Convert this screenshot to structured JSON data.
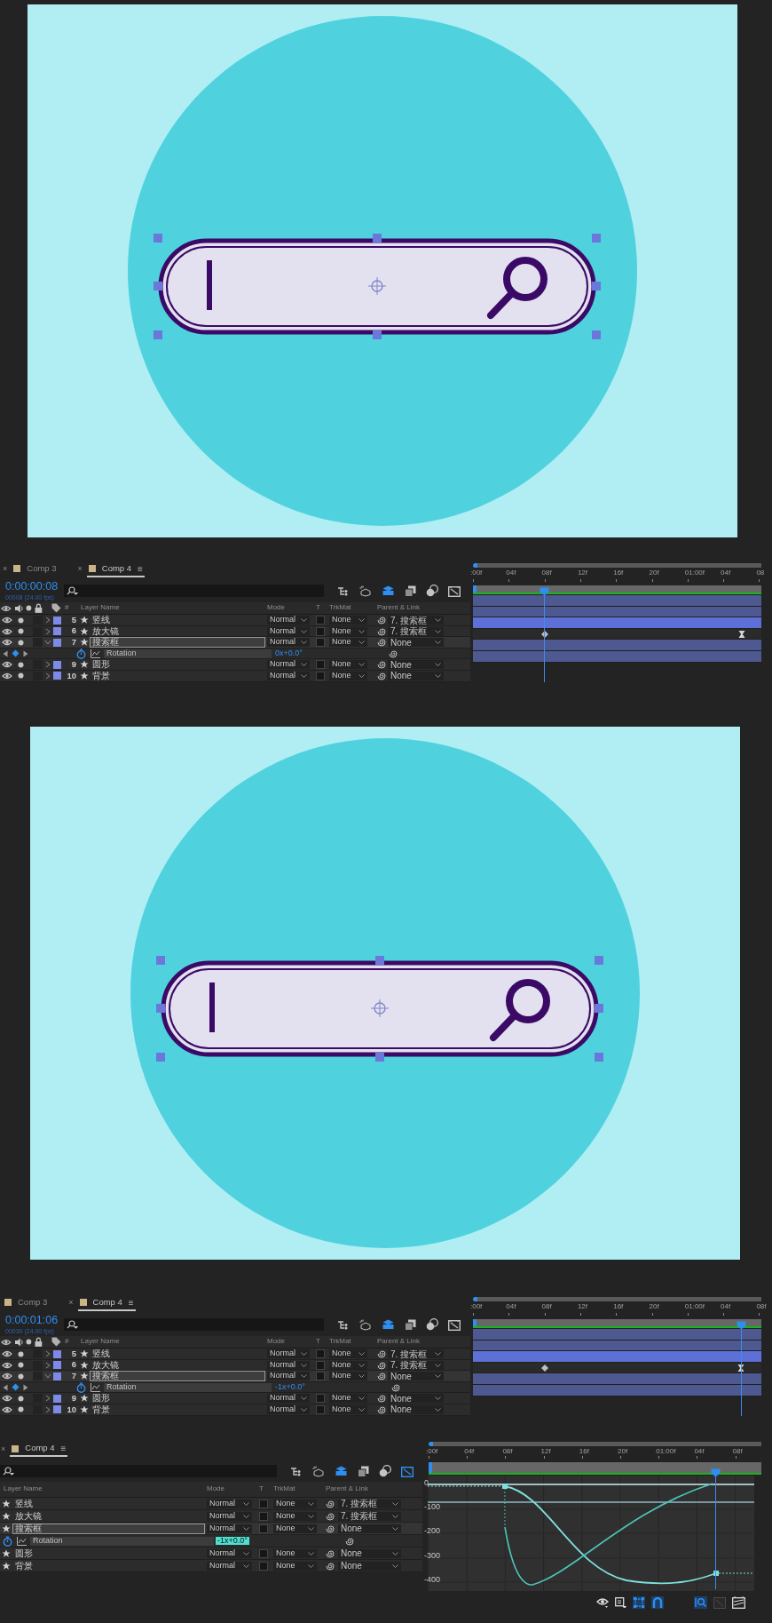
{
  "panels": [
    {
      "kind": "viewer"
    },
    {
      "kind": "timeline",
      "tabs": [
        {
          "label": "Comp 3",
          "selected": false,
          "close": "×"
        },
        {
          "label": "Comp 4",
          "selected": true,
          "close": "×",
          "menu": "≡"
        }
      ],
      "timecode": "0:00:00:08",
      "frame_info": "00008 (24.00 fps)",
      "header": {
        "number": "#",
        "layer_name": "Layer Name",
        "mode": "Mode",
        "t": "T",
        "trkmat": "TrkMat",
        "parent": "Parent & Link"
      },
      "ruler": [
        ":00f",
        "04f",
        "08f",
        "12f",
        "16f",
        "20f",
        "01:00f",
        "04f",
        "08"
      ],
      "playhead": {
        "level": 0.25
      },
      "rows": [
        {
          "kind": "layer",
          "number": "5",
          "name": "竖线",
          "mode": "Normal",
          "trkmat": "None",
          "parent": "7. 搜索框",
          "selected": false,
          "expanded": false
        },
        {
          "kind": "layer",
          "number": "6",
          "name": "放大镜",
          "mode": "Normal",
          "trkmat": "None",
          "parent": "7. 搜索框",
          "selected": false,
          "expanded": false
        },
        {
          "kind": "layer",
          "number": "7",
          "name": "搜索框",
          "mode": "Normal",
          "trkmat": "None",
          "parent": "None",
          "selected": true,
          "expanded": true
        },
        {
          "kind": "property",
          "name": "Rotation",
          "value": "0x+0.0°",
          "editing": false,
          "keyframes": [
            {
              "kind": "auto",
              "level": 0.25
            },
            {
              "kind": "ease",
              "level": 0.94
            }
          ]
        },
        {
          "kind": "layer",
          "number": "9",
          "name": "圆形",
          "mode": "Normal",
          "trkmat": "None",
          "parent": "None",
          "selected": false,
          "expanded": false
        },
        {
          "kind": "layer",
          "number": "10",
          "name": "背景",
          "mode": "Normal",
          "trkmat": "None",
          "parent": "None",
          "selected": false,
          "expanded": false
        }
      ]
    },
    {
      "kind": "viewer"
    },
    {
      "kind": "timeline",
      "tabs": [
        {
          "label": "Comp 3",
          "selected": false
        },
        {
          "label": "Comp 4",
          "selected": true,
          "close": "×",
          "menu": "≡"
        }
      ],
      "timecode": "0:00:01:06",
      "frame_info": "00030 (24.00 fps)",
      "header": {
        "number": "#",
        "layer_name": "Layer Name",
        "mode": "Mode",
        "t": "T",
        "trkmat": "TrkMat",
        "parent": "Parent & Link"
      },
      "ruler": [
        ":00f",
        "04f",
        "08f",
        "12f",
        "16f",
        "20f",
        "01:00f",
        "04f",
        "08f"
      ],
      "playhead": {
        "level": 0.9375
      },
      "rows": [
        {
          "kind": "layer",
          "number": "5",
          "name": "竖线",
          "mode": "Normal",
          "trkmat": "None",
          "parent": "7. 搜索框",
          "selected": false,
          "expanded": false
        },
        {
          "kind": "layer",
          "number": "6",
          "name": "放大镜",
          "mode": "Normal",
          "trkmat": "None",
          "parent": "7. 搜索框",
          "selected": false,
          "expanded": false
        },
        {
          "kind": "layer",
          "number": "7",
          "name": "搜索框",
          "mode": "Normal",
          "trkmat": "None",
          "parent": "None",
          "selected": true,
          "expanded": true
        },
        {
          "kind": "property",
          "name": "Rotation",
          "value": "-1x+0.0°",
          "editing": false,
          "keyframes": [
            {
              "kind": "auto",
              "level": 0.25
            },
            {
              "kind": "ease",
              "level": 0.9375
            }
          ]
        },
        {
          "kind": "layer",
          "number": "9",
          "name": "圆形",
          "mode": "Normal",
          "trkmat": "None",
          "parent": "None",
          "selected": false,
          "expanded": false
        },
        {
          "kind": "layer",
          "number": "10",
          "name": "背景",
          "mode": "Normal",
          "trkmat": "None",
          "parent": "None",
          "selected": false,
          "expanded": false
        }
      ]
    },
    {
      "kind": "graph_editor",
      "tabs": [
        {
          "label": "Comp 4",
          "selected": true,
          "close": "×",
          "menu": "≡"
        }
      ],
      "header": {
        "layer_name": "Layer Name",
        "mode": "Mode",
        "t": "T",
        "trkmat": "TrkMat",
        "parent": "Parent & Link"
      },
      "ruler": [
        ":00f",
        "04f",
        "08f",
        "12f",
        "16f",
        "20f",
        "01:00f",
        "04f",
        "08f"
      ],
      "playhead": {
        "level": 0.9375
      },
      "rows": [
        {
          "kind": "layer",
          "name": "竖线",
          "mode": "Normal",
          "trkmat": "None",
          "parent": "7. 搜索框",
          "selected": false
        },
        {
          "kind": "layer",
          "name": "放大镜",
          "mode": "Normal",
          "trkmat": "None",
          "parent": "7. 搜索框",
          "selected": false
        },
        {
          "kind": "layer",
          "name": "搜索框",
          "mode": "Normal",
          "trkmat": "None",
          "parent": "None",
          "selected": true
        },
        {
          "kind": "property",
          "name": "Rotation",
          "value": "-1x+0.0°",
          "editing": true
        },
        {
          "kind": "layer",
          "name": "圆形",
          "mode": "Normal",
          "trkmat": "None",
          "parent": "None",
          "selected": false
        },
        {
          "kind": "layer",
          "name": "背景",
          "mode": "Normal",
          "trkmat": "None",
          "parent": "None",
          "selected": false
        }
      ],
      "graph": {
        "y_labels": [
          "0",
          "-100",
          "-200",
          "-300",
          "-400"
        ]
      }
    }
  ]
}
